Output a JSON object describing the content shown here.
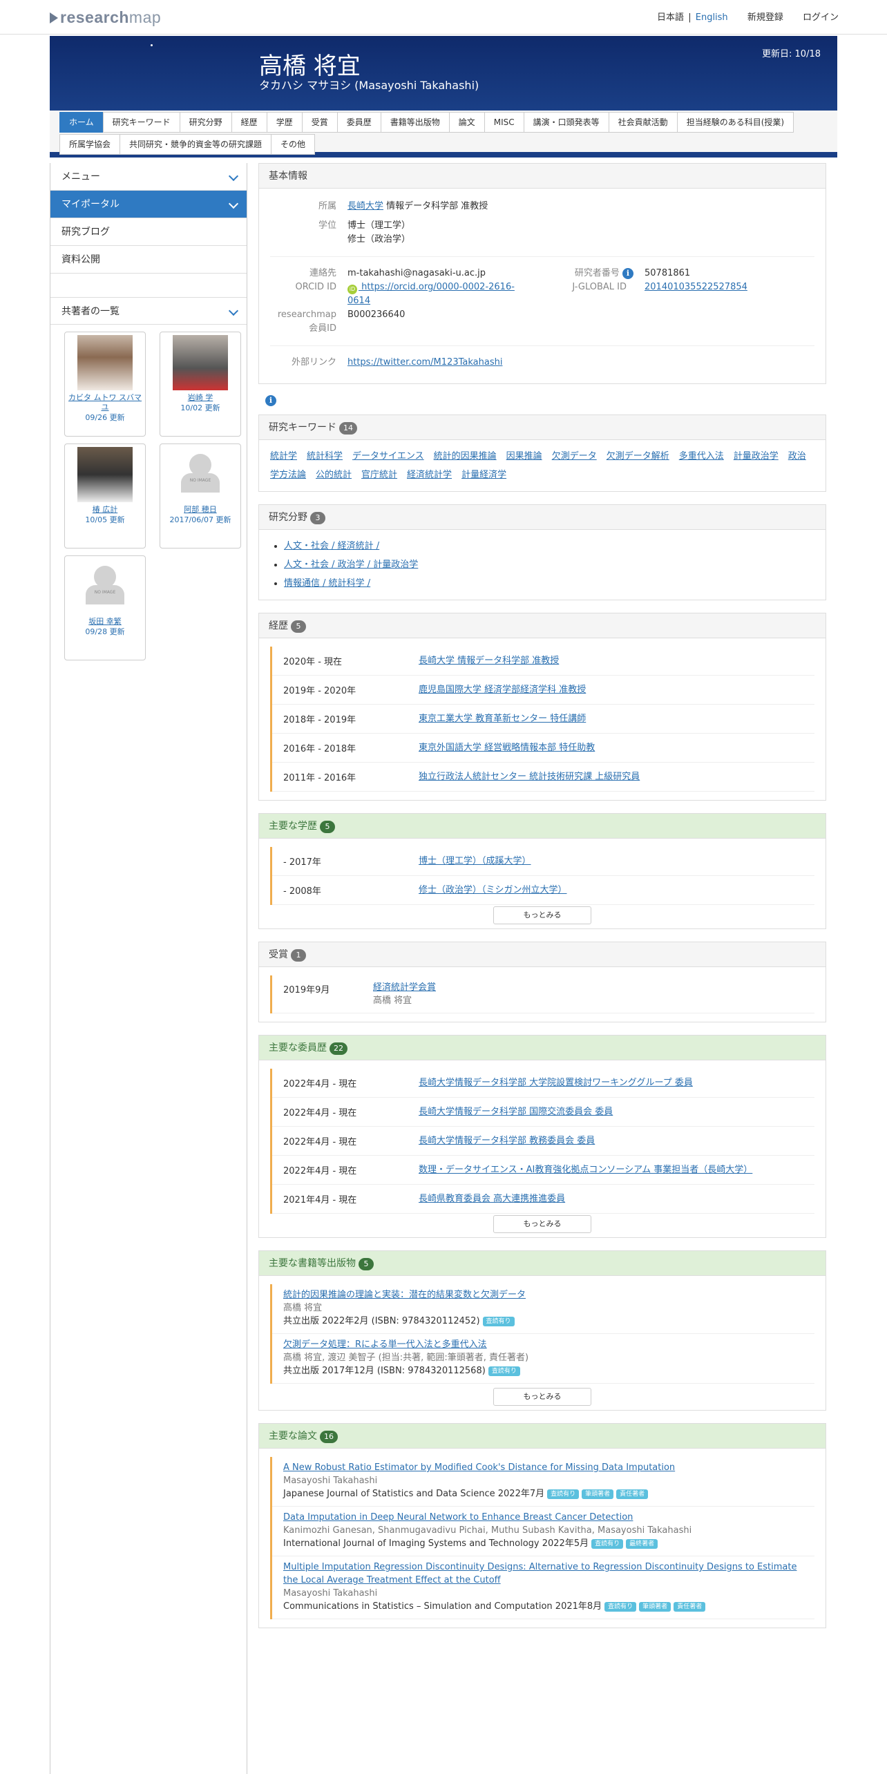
{
  "header": {
    "logo_bold": "research",
    "logo_rest": "map",
    "lang_ja": "日本語",
    "lang_sep": "|",
    "lang_en": "English",
    "signup": "新規登録",
    "login": "ログイン"
  },
  "profile": {
    "name": "高橋 将宜",
    "kana": "タカハシ マサヨシ  (Masayoshi Takahashi)",
    "updated": "更新日: 10/18"
  },
  "tabs": [
    "ホーム",
    "研究キーワード",
    "研究分野",
    "経歴",
    "学歴",
    "受賞",
    "委員歴",
    "書籍等出版物",
    "論文",
    "MISC",
    "講演・口頭発表等",
    "社会貢献活動",
    "担当経験のある科目(授業)",
    "所属学協会",
    "共同研究・競争的資金等の研究課題",
    "その他"
  ],
  "sidebar": {
    "menu": "メニュー",
    "myportal": "マイポータル",
    "blog": "研究ブログ",
    "materials": "資料公開",
    "coauthors_title": "共著者の一覧",
    "coauthors": [
      {
        "name": "カビタ ムトワ スバマユ",
        "date": "09/26 更新",
        "photo": "p1"
      },
      {
        "name": "岩崎 学",
        "date": "10/02 更新",
        "photo": "p2"
      },
      {
        "name": "椿 広計",
        "date": "10/05 更新",
        "photo": "p3"
      },
      {
        "name": "阿部 穂日",
        "date": "2017/06/07 更新",
        "photo": "no"
      },
      {
        "name": "坂田 幸繁",
        "date": "09/28 更新",
        "photo": "no"
      }
    ]
  },
  "basic": {
    "title": "基本情報",
    "aff_label": "所属",
    "aff_link": "長崎大学",
    "aff_rest": " 情報データ科学部 准教授",
    "deg_label": "学位",
    "deg1": "博士（理工学）",
    "deg2": "修士（政治学）",
    "contact_label": "連絡先",
    "contact": "m-takahashi@nagasaki-u.ac.jp",
    "orcid_label": "ORCID ID",
    "orcid": " https://orcid.org/0000-0002-2616-0614",
    "rmid_label": "researchmap会員ID",
    "rmid": "B000236640",
    "resno_label": "研究者番号",
    "resno": "50781861",
    "jg_label": "J-GLOBAL ID",
    "jg": "201401035522527854",
    "ext_label": "外部リンク",
    "ext": "https://twitter.com/M123Takahashi"
  },
  "keywords": {
    "title": "研究キーワード",
    "count": "14",
    "items": [
      "統計学",
      "統計科学",
      "データサイエンス",
      "統計的因果推論",
      "因果推論",
      "欠測データ",
      "欠測データ解析",
      "多重代入法",
      "計量政治学",
      "政治学方法論",
      "公的統計",
      "官庁統計",
      "経済統計学",
      "計量経済学"
    ]
  },
  "fields": {
    "title": "研究分野",
    "count": "3",
    "items": [
      "人文・社会 / 経済統計 /",
      "人文・社会 / 政治学 / 計量政治学",
      "情報通信 / 統計科学 /"
    ]
  },
  "career": {
    "title": "経歴",
    "count": "5",
    "items": [
      {
        "d": "2020年 - 現在",
        "t": "長崎大学 情報データ科学部 准教授"
      },
      {
        "d": "2019年 - 2020年",
        "t": "鹿児島国際大学 経済学部経済学科 准教授"
      },
      {
        "d": "2018年 - 2019年",
        "t": "東京工業大学 教育革新センター 特任講師"
      },
      {
        "d": "2016年 - 2018年",
        "t": "東京外国語大学 経営戦略情報本部 特任助教"
      },
      {
        "d": "2011年 - 2016年",
        "t": "独立行政法人統計センター 統計技術研究課 上級研究員"
      }
    ]
  },
  "education": {
    "title": "主要な学歴",
    "count": "5",
    "more": "もっとみる",
    "items": [
      {
        "d": "- 2017年",
        "t": "博士（理工学）（成蹊大学）"
      },
      {
        "d": "- 2008年",
        "t": "修士（政治学）（ミシガン州立大学）"
      }
    ]
  },
  "awards": {
    "title": "受賞",
    "count": "1",
    "date": "2019年9月",
    "name": "経済統計学会賞",
    "who": "高橋 将宜"
  },
  "committee": {
    "title": "主要な委員歴",
    "count": "22",
    "more": "もっとみる",
    "items": [
      {
        "d": "2022年4月 - 現在",
        "t": "長崎大学情報データ科学部 大学院設置検討ワーキンググループ 委員"
      },
      {
        "d": "2022年4月 - 現在",
        "t": "長崎大学情報データ科学部 国際交流委員会 委員"
      },
      {
        "d": "2022年4月 - 現在",
        "t": "長崎大学情報データ科学部 教務委員会 委員"
      },
      {
        "d": "2022年4月 - 現在",
        "t": "数理・データサイエンス・AI教育強化拠点コンソーシアム 事業担当者（長崎大学）"
      },
      {
        "d": "2021年4月 - 現在",
        "t": "長崎県教育委員会 高大連携推進委員"
      }
    ]
  },
  "books": {
    "title": "主要な書籍等出版物",
    "count": "5",
    "more": "もっとみる",
    "items": [
      {
        "t": "統計的因果推論の理論と実装：潜在的結果変数と欠測データ",
        "a": "高橋 将宜",
        "p": "共立出版 2022年2月 (ISBN: 9784320112452)",
        "b": [
          "査読有り"
        ]
      },
      {
        "t": "欠測データ処理：Rによる単一代入法と多重代入法",
        "a": "高橋 将宜, 渡辺 美智子 (担当:共著, 範囲:筆頭著者, 責任著者)",
        "p": "共立出版 2017年12月 (ISBN: 9784320112568)",
        "b": [
          "査読有り"
        ]
      }
    ]
  },
  "papers": {
    "title": "主要な論文",
    "count": "16",
    "items": [
      {
        "t": "A New Robust Ratio Estimator by Modified Cook's Distance for Missing Data Imputation",
        "a": "Masayoshi Takahashi",
        "p": "Japanese Journal of Statistics and Data Science 2022年7月",
        "b": [
          "査読有り",
          "筆頭著者",
          "責任著者"
        ]
      },
      {
        "t": "Data Imputation in Deep Neural Network to Enhance Breast Cancer Detection",
        "a": "Kanimozhi Ganesan, Shanmugavadivu Pichai, Muthu Subash Kavitha, Masayoshi Takahashi",
        "p": "International Journal of Imaging Systems and Technology 2022年5月",
        "b": [
          "査読有り",
          "最終著者"
        ]
      },
      {
        "t": "Multiple Imputation Regression Discontinuity Designs: Alternative to Regression Discontinuity Designs to Estimate the Local Average Treatment Effect at the Cutoff",
        "a": "Masayoshi Takahashi",
        "p": "Communications in Statistics – Simulation and Computation 2021年8月",
        "b": [
          "査読有り",
          "筆頭著者",
          "責任著者"
        ]
      }
    ]
  }
}
